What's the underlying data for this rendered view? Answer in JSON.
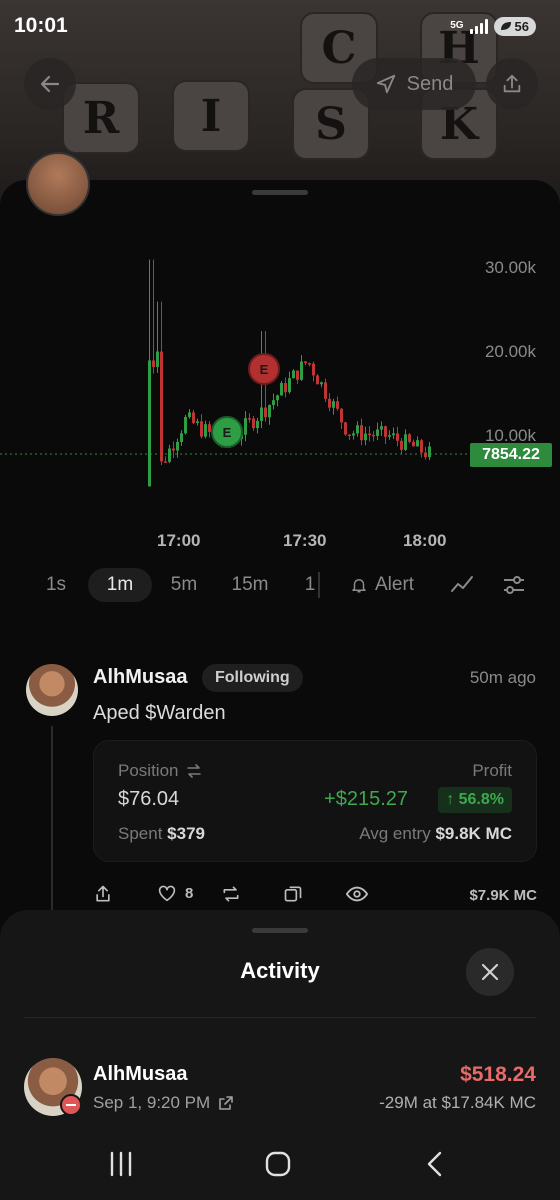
{
  "status_bar": {
    "time": "10:01",
    "network": "5G",
    "battery": "56"
  },
  "hero": {
    "letters": [
      "R",
      "I",
      "S",
      "K",
      "C",
      "H"
    ],
    "send_label": "Send"
  },
  "chart": {
    "y_ticks": [
      "30.00k",
      "20.00k",
      "10.00k"
    ],
    "x_ticks": [
      "17:00",
      "17:30",
      "18:00"
    ],
    "current_price": "7854.22",
    "markers": [
      "E",
      "E"
    ],
    "colors": {
      "up": "#2e9e45",
      "down": "#c03434"
    }
  },
  "chart_data": {
    "type": "candlestick",
    "title": "",
    "xlabel": "",
    "ylabel": "",
    "ylim": [
      0,
      32000
    ],
    "x": [
      "16:51",
      "17:00",
      "17:10",
      "17:20",
      "17:30",
      "17:40",
      "17:50",
      "18:00"
    ],
    "close": [
      4000,
      12000,
      9000,
      13500,
      19000,
      10500,
      10000,
      7854.22
    ],
    "current_price": 7854.22,
    "x_ticks": [
      "17:00",
      "17:30",
      "18:00"
    ],
    "y_ticks": [
      "10.00k",
      "20.00k",
      "30.00k"
    ]
  },
  "timeframes": {
    "items": [
      "1s",
      "1m",
      "5m",
      "15m",
      "1"
    ],
    "active": "1m",
    "alert_label": "Alert"
  },
  "post": {
    "user": "AlhMusaa",
    "follow_label": "Following",
    "time": "50m ago",
    "text": "Aped $Warden",
    "position_label": "Position",
    "position_value": "$76.04",
    "profit_label": "Profit",
    "profit_value": "+$215.27",
    "profit_pct": "↑ 56.8%",
    "spent_label": "Spent",
    "spent_value": "$379",
    "avg_entry_label": "Avg entry",
    "avg_entry_value": "$9.8K MC",
    "likes": "8",
    "market_cap": "$7.9K MC"
  },
  "activity": {
    "title": "Activity",
    "user": "AlhMusaa",
    "date": "Sep 1, 9:20 PM",
    "amount": "$518.24",
    "detail": "-29M at $17.84K MC"
  }
}
